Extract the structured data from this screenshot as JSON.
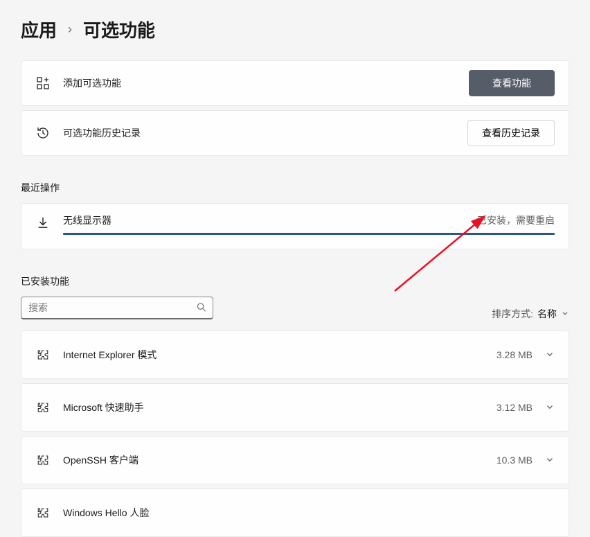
{
  "breadcrumb": {
    "parent": "应用",
    "current": "可选功能"
  },
  "add_card": {
    "label": "添加可选功能",
    "button": "查看功能"
  },
  "history_card": {
    "label": "可选功能历史记录",
    "button": "查看历史记录"
  },
  "recent": {
    "title": "最近操作",
    "item": {
      "name": "无线显示器",
      "status": "已安装，需要重启"
    }
  },
  "installed": {
    "title": "已安装功能",
    "search_placeholder": "搜索",
    "sort_label": "排序方式:",
    "sort_value": "名称"
  },
  "features": [
    {
      "name": "Internet Explorer 模式",
      "size": "3.28 MB"
    },
    {
      "name": "Microsoft 快速助手",
      "size": "3.12 MB"
    },
    {
      "name": "OpenSSH 客户端",
      "size": "10.3 MB"
    },
    {
      "name": "Windows Hello 人脸",
      "size": ""
    }
  ]
}
